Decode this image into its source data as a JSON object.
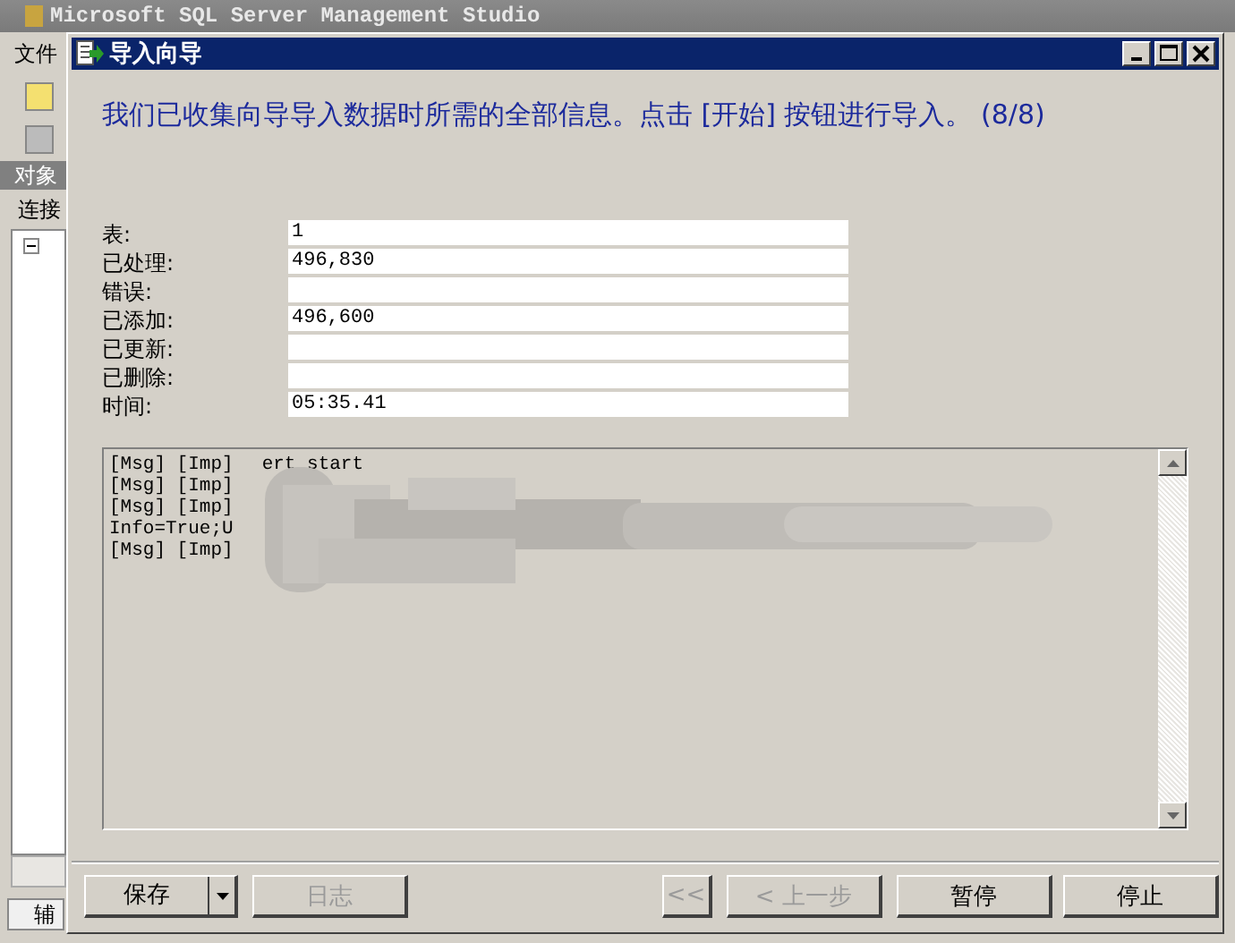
{
  "background_window": {
    "title": "Microsoft SQL Server Management Studio",
    "menu_item": "文件",
    "panel_title": "对象",
    "connect_label": "连接",
    "tab_label": "辅"
  },
  "dialog": {
    "title": "导入向导",
    "heading": "我们已收集向导导入数据时所需的全部信息。点击 [开始] 按钮进行导入。 (8/8)",
    "fields": [
      {
        "label": "表:",
        "value": "1"
      },
      {
        "label": "已处理:",
        "value": "496,830"
      },
      {
        "label": "错误:"
      },
      {
        "label": "已添加:",
        "value": "496,600"
      },
      {
        "label": "已更新:"
      },
      {
        "label": "已删除:"
      },
      {
        "label": "时间:",
        "value": "05:35.41"
      }
    ],
    "log": [
      {
        "text": "[Msg] [Imp]",
        "tail": "ert start"
      },
      {
        "text": "[Msg] [Imp]"
      },
      {
        "text": "[Msg] [Imp]"
      },
      {
        "text": "Info=True;U"
      },
      {
        "text": "[Msg] [Imp]"
      }
    ],
    "buttons": [
      {
        "label": "保存",
        "kind": "split",
        "disabled": false
      },
      {
        "label": "日志",
        "kind": "plain",
        "disabled": true
      },
      {
        "label": "<<",
        "kind": "small",
        "disabled": true
      },
      {
        "label": "< 上一步",
        "kind": "plain",
        "disabled": true
      },
      {
        "label": "暂停",
        "kind": "plain",
        "disabled": false
      },
      {
        "label": "停止",
        "kind": "plain",
        "disabled": false
      }
    ]
  }
}
